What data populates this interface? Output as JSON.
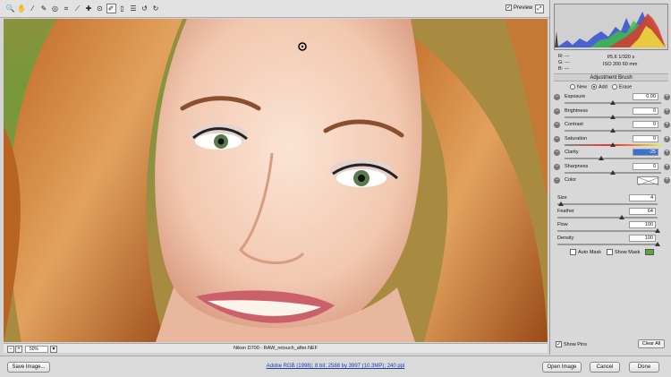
{
  "toolbar": {
    "tools": [
      {
        "icon": "zoom-icon",
        "glyph": "🔍"
      },
      {
        "icon": "hand-icon",
        "glyph": "✋"
      },
      {
        "icon": "white-balance-icon",
        "glyph": "⁄"
      },
      {
        "icon": "color-sampler-icon",
        "glyph": "✎"
      },
      {
        "icon": "targeted-adjustment-icon",
        "glyph": "◎"
      },
      {
        "icon": "crop-icon",
        "glyph": "⌗"
      },
      {
        "icon": "straighten-icon",
        "glyph": "⟋"
      },
      {
        "icon": "spot-removal-icon",
        "glyph": "✚"
      },
      {
        "icon": "red-eye-icon",
        "glyph": "⊙"
      },
      {
        "icon": "adjustment-brush-icon",
        "glyph": "✐"
      },
      {
        "icon": "graduated-filter-icon",
        "glyph": "▯"
      },
      {
        "icon": "preferences-icon",
        "glyph": "☰"
      },
      {
        "icon": "rotate-ccw-icon",
        "glyph": "↺"
      },
      {
        "icon": "rotate-cw-icon",
        "glyph": "↻"
      }
    ],
    "preview_label": "Preview",
    "preview_checked": "✓",
    "fullscreen_glyph": "⤢"
  },
  "canvas": {
    "zoom": "50%",
    "zoom_minus": "−",
    "zoom_plus": "+",
    "zoom_arrow": "▾",
    "filename": "Nikon D700  -  RAW_retouch_after.NEF"
  },
  "readout": {
    "r": "R:   ---",
    "g": "G:   ---",
    "b": "B:   ---",
    "exposure_info": "f/5.6   1/320 s",
    "iso_info": "ISO 200   60 mm"
  },
  "adjustment_brush": {
    "title": "Adjustment Brush",
    "modes": [
      "New",
      "Add",
      "Erase"
    ],
    "selected_mode": "Add",
    "sliders": [
      {
        "label": "Exposure",
        "value": "0.00",
        "position": 0.5
      },
      {
        "label": "Brightness",
        "value": "0",
        "position": 0.5
      },
      {
        "label": "Contrast",
        "value": "0",
        "position": 0.5
      },
      {
        "label": "Saturation",
        "value": "0",
        "position": 0.5
      },
      {
        "label": "Clarity",
        "value": "-25",
        "position": 0.38
      },
      {
        "label": "Sharpness",
        "value": "0",
        "position": 0.5
      }
    ],
    "color_label": "Color",
    "minus_glyph": "−",
    "plus_glyph": "+",
    "brush": [
      {
        "label": "Size",
        "value": "4",
        "position": 0.04
      },
      {
        "label": "Feather",
        "value": "64",
        "position": 0.64
      },
      {
        "label": "Flow",
        "value": "100",
        "position": 1.0
      },
      {
        "label": "Density",
        "value": "100",
        "position": 1.0
      }
    ],
    "auto_mask_label": "Auto Mask",
    "show_mask_label": "Show Mask",
    "mask_color": "#5aa83c",
    "show_pins_label": "Show Pins",
    "show_pins_checked": "✓",
    "clear_all_label": "Clear All"
  },
  "bottom_bar": {
    "save_label": "Save Image...",
    "workflow_text": "Adobe RGB (1998); 8 bit; 2588 by 3997 (10.3MP); 240 ppi",
    "open_label": "Open Image",
    "cancel_label": "Cancel",
    "done_label": "Done"
  }
}
